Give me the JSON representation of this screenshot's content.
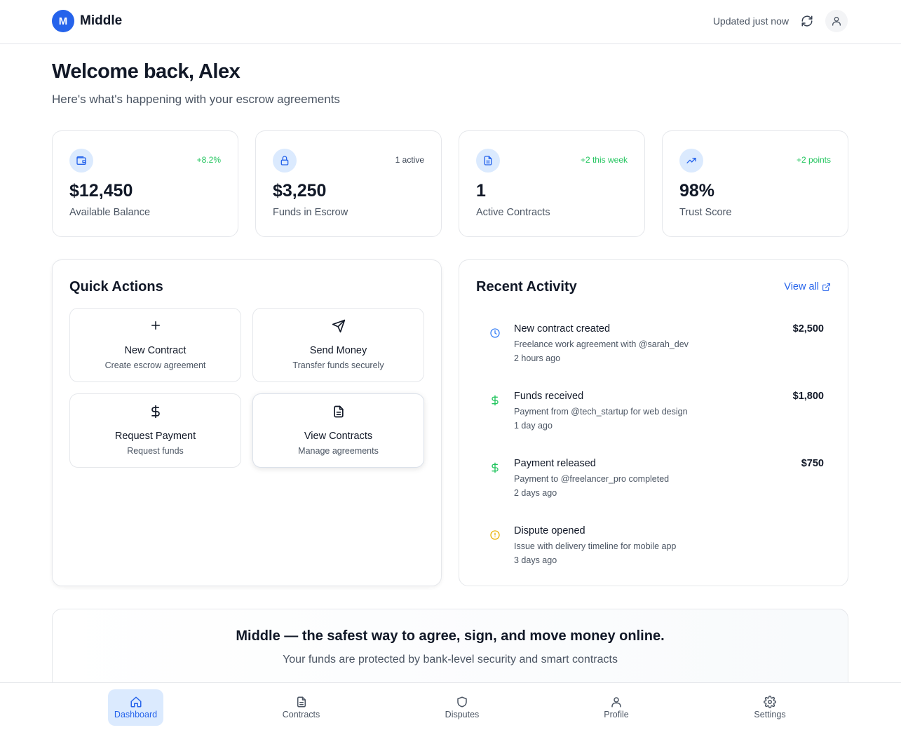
{
  "header": {
    "logo_letter": "M",
    "app_name": "Middle",
    "updated_text": "Updated just now",
    "refresh_icon": "refresh-icon",
    "avatar_icon": "user-icon"
  },
  "welcome": {
    "title": "Welcome back, Alex",
    "subtitle": "Here's what's happening with your escrow agreements"
  },
  "stats": [
    {
      "icon": "wallet-icon",
      "badge": "+8.2%",
      "badge_color": "#22c55e",
      "value": "$12,450",
      "label": "Available Balance"
    },
    {
      "icon": "lock-icon",
      "badge": "1 active",
      "badge_color": "#374151",
      "value": "$3,250",
      "label": "Funds in Escrow"
    },
    {
      "icon": "document-icon",
      "badge": "+2 this week",
      "badge_color": "#22c55e",
      "value": "1",
      "label": "Active Contracts"
    },
    {
      "icon": "trending-up-icon",
      "badge": "+2 points",
      "badge_color": "#22c55e",
      "value": "98%",
      "label": "Trust Score"
    }
  ],
  "quick_actions": {
    "title": "Quick Actions",
    "items": [
      {
        "icon": "plus-icon",
        "label": "New Contract",
        "desc": "Create escrow agreement"
      },
      {
        "icon": "send-icon",
        "label": "Send Money",
        "desc": "Transfer funds securely"
      },
      {
        "icon": "dollar-icon",
        "label": "Request Payment",
        "desc": "Request funds"
      },
      {
        "icon": "file-icon",
        "label": "View Contracts",
        "desc": "Manage agreements"
      }
    ]
  },
  "recent_activity": {
    "title": "Recent Activity",
    "view_all": "View all",
    "items": [
      {
        "icon": "clock-icon",
        "icon_color": "#3b82f6",
        "title": "New contract created",
        "desc": "Freelance work agreement with @sarah_dev",
        "time": "2 hours ago",
        "amount": "$2,500"
      },
      {
        "icon": "dollar-icon",
        "icon_color": "#22c55e",
        "title": "Funds received",
        "desc": "Payment from @tech_startup for web design",
        "time": "1 day ago",
        "amount": "$1,800"
      },
      {
        "icon": "dollar-icon",
        "icon_color": "#22c55e",
        "title": "Payment released",
        "desc": "Payment to @freelancer_pro completed",
        "time": "2 days ago",
        "amount": "$750"
      },
      {
        "icon": "alert-circle-icon",
        "icon_color": "#eab308",
        "title": "Dispute opened",
        "desc": "Issue with delivery timeline for mobile app",
        "time": "3 days ago",
        "amount": ""
      }
    ]
  },
  "banner": {
    "title": "Middle — the safest way to agree, sign, and move money online.",
    "subtitle": "Your funds are protected by bank-level security and smart contracts"
  },
  "bottom_nav": [
    {
      "icon": "home-icon",
      "label": "Dashboard",
      "active": true
    },
    {
      "icon": "file-icon",
      "label": "Contracts",
      "active": false
    },
    {
      "icon": "shield-icon",
      "label": "Disputes",
      "active": false
    },
    {
      "icon": "user-icon",
      "label": "Profile",
      "active": false
    },
    {
      "icon": "gear-icon",
      "label": "Settings",
      "active": false
    }
  ],
  "colors": {
    "accent": "#2563eb",
    "positive": "#22c55e",
    "warning": "#eab308"
  }
}
